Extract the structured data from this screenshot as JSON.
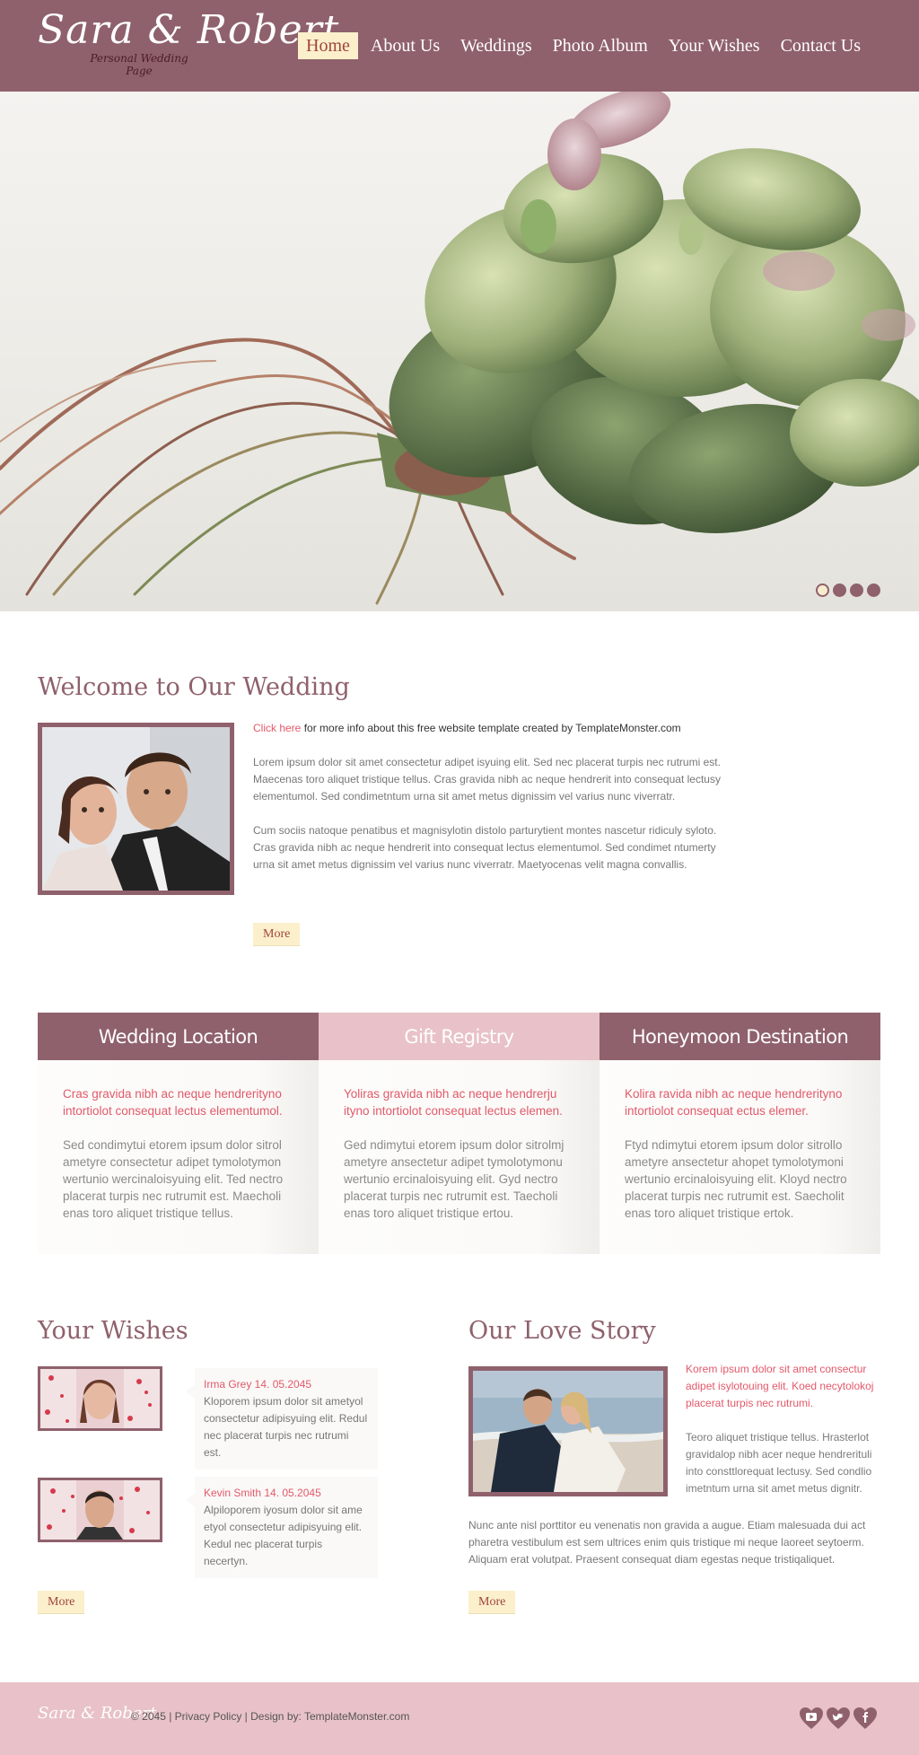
{
  "header": {
    "logo_script": "Sara & Robert",
    "logo_sub": "Personal Wedding Page",
    "nav": [
      {
        "label": "Home",
        "active": true
      },
      {
        "label": "About Us",
        "active": false
      },
      {
        "label": "Weddings",
        "active": false
      },
      {
        "label": "Photo Album",
        "active": false
      },
      {
        "label": "Your Wishes",
        "active": false
      },
      {
        "label": "Contact Us",
        "active": false
      }
    ]
  },
  "slider": {
    "slide_count": 4,
    "active_index": 0
  },
  "welcome": {
    "title": "Welcome to Our Wedding",
    "link_text": "Click here",
    "link_rest": " for more info about this free website template created by TemplateMonster.com",
    "paragraph1": "Lorem ipsum dolor sit amet consectetur adipet isyuing elit. Sed nec placerat turpis nec rutrumi est. Maecenas toro aliquet tristique tellus. Cras gravida nibh ac neque hendrerit into consequat lectusy elementumol. Sed condimetntum urna sit amet metus dignissim vel varius nunc viverratr.",
    "paragraph2": "Cum sociis natoque penatibus et magnisylotin distolo parturytient montes nascetur ridiculy syloto. Cras gravida nibh ac neque hendrerit into consequat lectus elementumol. Sed condimet ntumerty urna sit amet metus dignissim vel varius nunc viverratr. Maetyocenas velit magna convallis.",
    "more_label": "More"
  },
  "columns": [
    {
      "title": "Wedding Location",
      "lead": "Cras gravida nibh ac neque hendrerityno intortiolot consequat lectus elementumol.",
      "text": "Sed condimytui etorem ipsum dolor sitrol ametyre consectetur adipet tymolotymon wertunio wercinaloisyuing elit. Ted nectro placerat turpis nec rutrumit est. Maecholi enas toro aliquet tristique tellus."
    },
    {
      "title": "Gift Registry",
      "lead": "Yoliras gravida nibh ac neque hendrerju ityno intortiolot consequat lectus elemen.",
      "text": "Ged ndimytui etorem ipsum dolor sitrolmj ametyre ansectetur adipet tymolotymonu wertunio ercinaloisyuing elit. Gyd nectro placerat turpis nec rutrumit est. Taecholi enas toro aliquet tristique ertou."
    },
    {
      "title": "Honeymoon Destination",
      "lead": "Kolira ravida nibh ac neque hendrerityno intortiolot consequat ectus elemer.",
      "text": "Ftyd ndimytui etorem ipsum dolor sitrollo ametyre ansectetur ahopet tymolotymoni wertunio ercinaloisyuing elit. Kloyd nectro placerat turpis nec rutrumit est. Saecholit enas toro aliquet tristique ertok."
    }
  ],
  "wishes": {
    "title": "Your Wishes",
    "items": [
      {
        "name": "Irma Grey 14. 05.2045",
        "text": "Kloporem ipsum dolor sit ametyol consectetur adipisyuing elit. Redul nec placerat turpis nec rutrumi est."
      },
      {
        "name": "Kevin Smith 14. 05.2045",
        "text": "Alpiloporem iyosum dolor sit ame etyol consectetur adipisyuing elit. Kedul nec placerat turpis necertyn."
      }
    ],
    "more_label": "More"
  },
  "love_story": {
    "title": "Our Love Story",
    "lead": "Korem ipsum dolor sit amet consectur adipet isylotouing elit. Koed necytolokoj placerat turpis nec rutrumi.",
    "side_text": "Teoro aliquet tristique tellus. Hrasterlot gravidalop nibh acer neque hendrerituli into consttlorequat lectusy. Sed condlio imetntum urna sit amet metus dignitr.",
    "bottom_text": "Nunc ante nisl porttitor eu venenatis non gravida a augue. Etiam malesuada dui act pharetra vestibulum est sem ultrices enim quis tristique mi neque laoreet seytoerm. Aliquam erat volutpat. Praesent consequat diam egestas neque tristiqaliquet.",
    "more_label": "More"
  },
  "footer": {
    "logo_script": "Sara & Robert",
    "text": "© 2045 | Privacy Policy | Design by: TemplateMonster.com",
    "social": [
      "youtube-icon",
      "twitter-icon",
      "facebook-icon"
    ]
  },
  "colors": {
    "primary": "#8f616c",
    "light_pink": "#e8c2c8",
    "accent_pink": "#e2596a",
    "button_cream": "#fbf0cb"
  }
}
